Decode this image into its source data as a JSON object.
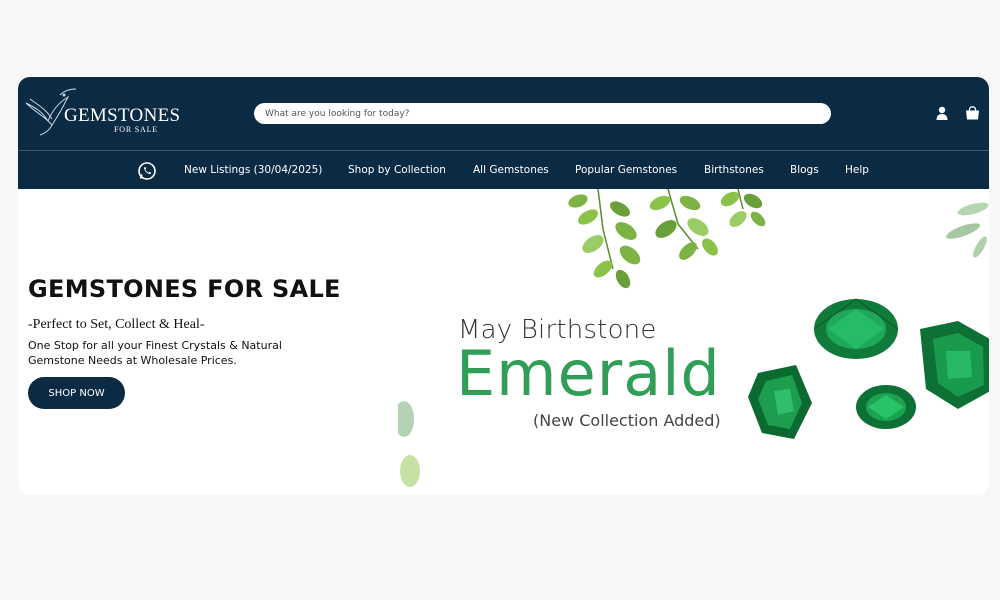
{
  "header": {
    "logo_text": "GEMSTONES",
    "logo_sub": "FOR SALE",
    "search_placeholder": "What are you looking for today?",
    "icons": [
      "account-icon",
      "cart-icon"
    ]
  },
  "nav": {
    "whatsapp_icon": "whatsapp-icon",
    "items": [
      {
        "label": "New Listings (30/04/2025)"
      },
      {
        "label": "Shop by Collection"
      },
      {
        "label": "All Gemstones"
      },
      {
        "label": "Popular Gemstones"
      },
      {
        "label": "Birthstones"
      },
      {
        "label": "Blogs"
      },
      {
        "label": "Help"
      }
    ]
  },
  "hero": {
    "title": "GEMSTONES FOR SALE",
    "tagline": "-Perfect to Set, Collect & Heal-",
    "description": "One Stop for all your Finest Crystals & Natural Gemstone Needs at Wholesale Prices.",
    "cta_label": "SHOP NOW"
  },
  "banner": {
    "subtitle": "May Birthstone",
    "headline": "Emerald",
    "note": "(New Collection Added)"
  },
  "colors": {
    "brand_navy": "#0b2b45",
    "emerald_green": "#2f9e56",
    "page_bg": "#f7f7f7"
  }
}
